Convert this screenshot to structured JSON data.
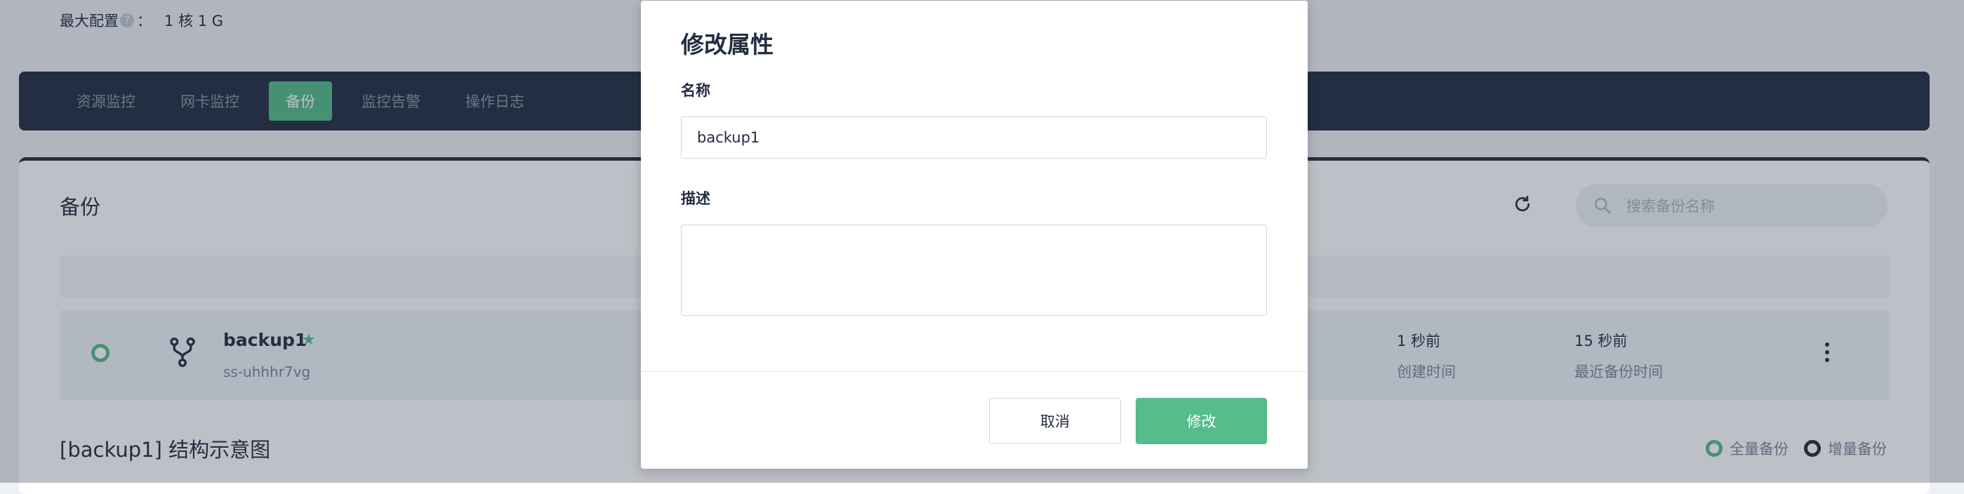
{
  "header": {
    "max_config_label": "最大配置",
    "max_config_help": "?",
    "max_config_value": "1 核 1 G"
  },
  "tabs": [
    {
      "label": "资源监控",
      "active": false
    },
    {
      "label": "网卡监控",
      "active": false
    },
    {
      "label": "备份",
      "active": true
    },
    {
      "label": "监控告警",
      "active": false
    },
    {
      "label": "操作日志",
      "active": false
    }
  ],
  "backup_section": {
    "title": "备份",
    "search_placeholder": "搜索备份名称",
    "item": {
      "name": "backup1",
      "starred": true,
      "star_glyph": "★",
      "id": "ss-uhhhr7vg",
      "created_value": "1 秒前",
      "created_label": "创建时间",
      "last_backup_value": "15 秒前",
      "last_backup_label": "最近备份时间"
    }
  },
  "structure": {
    "title": "[backup1] 结构示意图",
    "legend_full": "全量备份",
    "legend_incremental": "增量备份"
  },
  "modal": {
    "title": "修改属性",
    "name_label": "名称",
    "name_value": "backup1",
    "description_label": "描述",
    "description_value": "",
    "cancel_label": "取消",
    "submit_label": "修改"
  },
  "colors": {
    "accent": "#55bc8a",
    "dark": "#242e42",
    "muted": "#79879c"
  }
}
